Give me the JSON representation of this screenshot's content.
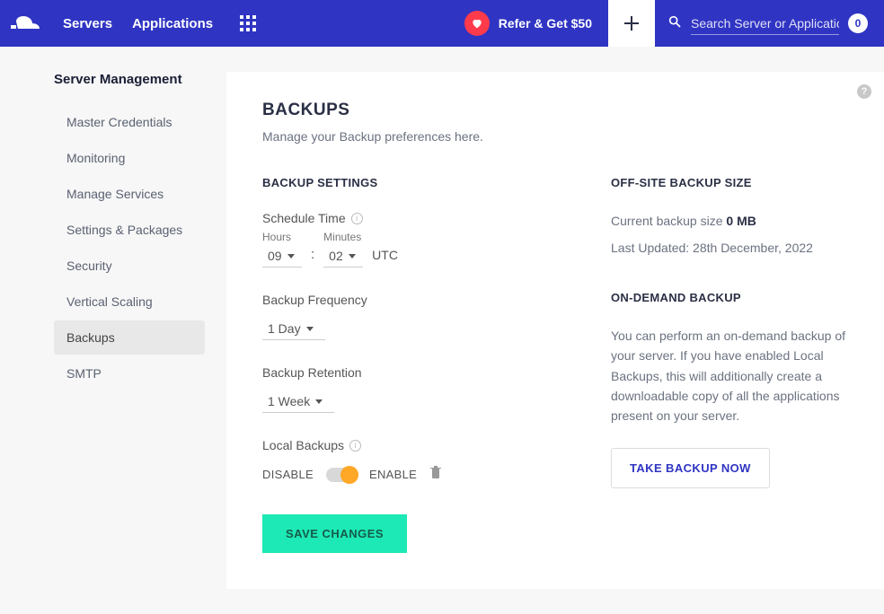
{
  "topnav": {
    "servers": "Servers",
    "applications": "Applications",
    "refer": "Refer & Get $50",
    "search_placeholder": "Search Server or Application",
    "count": "0"
  },
  "sidebar": {
    "title": "Server Management",
    "items": [
      "Master Credentials",
      "Monitoring",
      "Manage Services",
      "Settings & Packages",
      "Security",
      "Vertical Scaling",
      "Backups",
      "SMTP"
    ]
  },
  "page": {
    "title": "BACKUPS",
    "subtitle": "Manage your Backup preferences here."
  },
  "settings": {
    "heading": "BACKUP SETTINGS",
    "schedule_label": "Schedule Time",
    "hours_label": "Hours",
    "minutes_label": "Minutes",
    "hours_value": "09",
    "minutes_value": "02",
    "tz": "UTC",
    "freq_label": "Backup Frequency",
    "freq_value": "1 Day",
    "retention_label": "Backup Retention",
    "retention_value": "1 Week",
    "local_label": "Local Backups",
    "disable": "DISABLE",
    "enable": "ENABLE",
    "save": "SAVE CHANGES"
  },
  "offsite": {
    "heading": "OFF-SITE BACKUP SIZE",
    "size_label": "Current backup size ",
    "size_value": "0 MB",
    "updated": "Last Updated: 28th December, 2022"
  },
  "ondemand": {
    "heading": "ON-DEMAND BACKUP",
    "desc": "You can perform an on-demand backup of your server. If you have enabled Local Backups, this will additionally create a downloadable copy of all the applications present on your server.",
    "button": "TAKE BACKUP NOW"
  }
}
